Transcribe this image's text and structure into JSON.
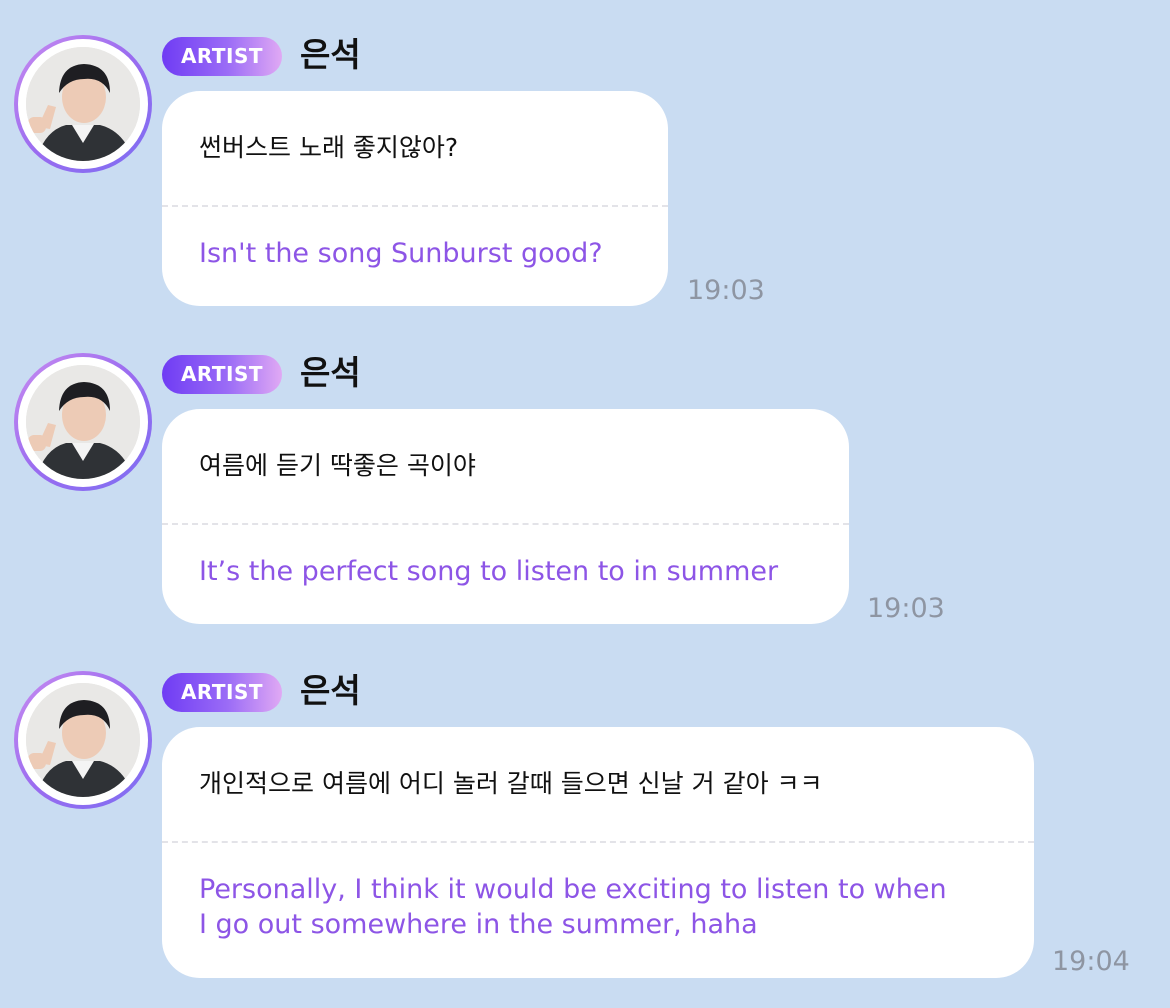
{
  "badge_label": "ARTIST",
  "colors": {
    "background": "#c9dcf2",
    "translation_text": "#8d55e6",
    "badge_gradient": [
      "#6f3cf4",
      "#e0a9f4"
    ],
    "timestamp": "#8e95a2"
  },
  "messages": [
    {
      "sender": "은석",
      "original": "썬버스트 노래 좋지않아?",
      "translation": "Isn't the song Sunburst good?",
      "time": "19:03"
    },
    {
      "sender": "은석",
      "original": "여름에 듣기 딱좋은 곡이야",
      "translation": "It’s the perfect song to listen to in summer",
      "time": "19:03"
    },
    {
      "sender": "은석",
      "original": "개인적으로 여름에 어디 놀러 갈때 들으면 신날 거 같아 ㅋㅋ",
      "translation_line1": "Personally, I think it would be exciting to listen to when",
      "translation_line2": "I go out somewhere in the summer, haha",
      "time": "19:04"
    }
  ]
}
